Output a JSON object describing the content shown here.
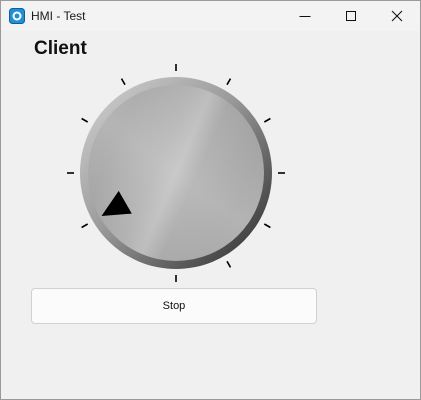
{
  "window": {
    "title": "HMI - Test",
    "controls": [
      "minimize",
      "maximize",
      "close"
    ]
  },
  "client": {
    "label": "Client"
  },
  "knob": {
    "tick_count": 11,
    "value_fraction": 0.0,
    "colors": {
      "face": "#a7a7a7",
      "rim_light": "#d4d4d4",
      "rim_dark": "#2e2e2e",
      "pointer": "#000000",
      "ticks": "#000000"
    }
  },
  "stop_button": {
    "label": "Stop"
  }
}
